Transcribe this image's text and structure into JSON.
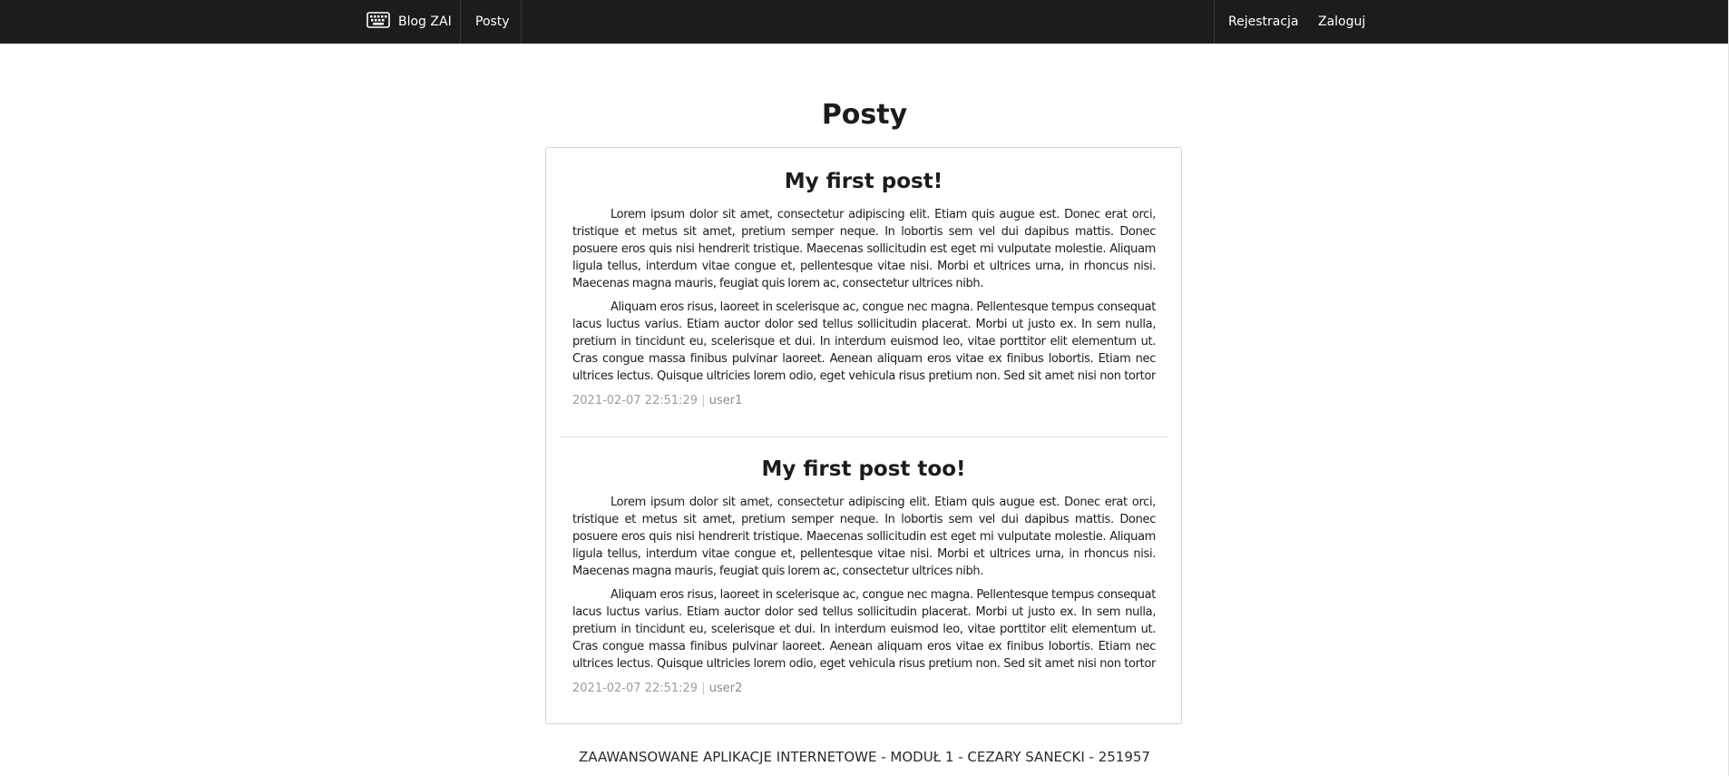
{
  "nav": {
    "brand_label": "Blog ZAI",
    "brand_icon": "keyboard-icon",
    "posts_label": "Posty",
    "register_label": "Rejestracja",
    "login_label": "Zaloguj"
  },
  "page": {
    "title": "Posty"
  },
  "posts": [
    {
      "title": "My first post!",
      "paragraphs": [
        "Lorem ipsum dolor sit amet, consectetur adipiscing elit. Etiam quis augue est. Donec erat orci, tristique et metus sit amet, pretium semper neque. In lobortis sem vel dui dapibus mattis. Donec posuere eros quis nisi hendrerit tristique. Maecenas sollicitudin est eget mi vulputate molestie. Aliquam ligula tellus, interdum vitae congue et, pellentesque vitae nisi. Morbi et ultrices urna, in rhoncus nisi. Maecenas magna mauris, feugiat quis lorem ac, consectetur ultrices nibh.",
        "Aliquam eros risus, laoreet in scelerisque ac, congue nec magna. Pellentesque tempus consequat lacus luctus varius. Etiam auctor dolor sed tellus sollicitudin placerat. Morbi ut justo ex. In sem nulla, pretium in tincidunt eu, scelerisque et dui. In interdum euismod leo, vitae porttitor elit elementum ut. Cras congue massa finibus pulvinar laoreet. Aenean aliquam eros vitae ex finibus lobortis. Etiam nec ultrices lectus. Quisque ultricies lorem odio, eget vehicula risus pretium non. Sed sit amet nisi non tortor convallis."
      ],
      "date": "2021-02-07 22:51:29",
      "separator": "|",
      "author": "user1"
    },
    {
      "title": "My first post too!",
      "paragraphs": [
        "Lorem ipsum dolor sit amet, consectetur adipiscing elit. Etiam quis augue est. Donec erat orci, tristique et metus sit amet, pretium semper neque. In lobortis sem vel dui dapibus mattis. Donec posuere eros quis nisi hendrerit tristique. Maecenas sollicitudin est eget mi vulputate molestie. Aliquam ligula tellus, interdum vitae congue et, pellentesque vitae nisi. Morbi et ultrices urna, in rhoncus nisi. Maecenas magna mauris, feugiat quis lorem ac, consectetur ultrices nibh.",
        "Aliquam eros risus, laoreet in scelerisque ac, congue nec magna. Pellentesque tempus consequat lacus luctus varius. Etiam auctor dolor sed tellus sollicitudin placerat. Morbi ut justo ex. In sem nulla, pretium in tincidunt eu, scelerisque et dui. In interdum euismod leo, vitae porttitor elit elementum ut. Cras congue massa finibus pulvinar laoreet. Aenean aliquam eros vitae ex finibus lobortis. Etiam nec ultrices lectus. Quisque ultricies lorem odio, eget vehicula risus pretium non. Sed sit amet nisi non tortor convallis."
      ],
      "date": "2021-02-07 22:51:29",
      "separator": "|",
      "author": "user2"
    }
  ],
  "footer": {
    "text": "ZAAWANSOWANE APLIKACJE INTERNETOWE - MODUŁ 1 - CEZARY SANECKI - 251957"
  },
  "colors": {
    "topbar": "#1b1c1d",
    "text": "#1b1c1d",
    "meta": "#9e9e9e",
    "panel_border": "#d4d4d5"
  }
}
